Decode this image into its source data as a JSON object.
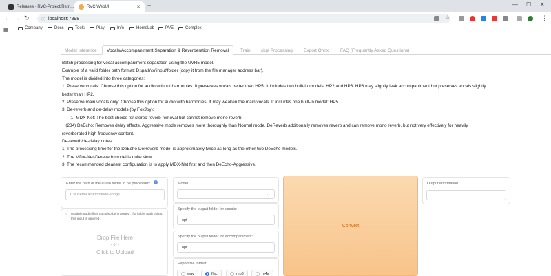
{
  "browser": {
    "tabs": [
      {
        "title": "Releases · RVC-Project/Retri…",
        "active": false
      },
      {
        "title": "RVC WebUI",
        "active": true
      }
    ],
    "url": "localhost:7898",
    "bookmarks": [
      "Company",
      "Docs",
      "Tools",
      "Play",
      "Info",
      "HomeLab",
      "PVE",
      "Complex"
    ]
  },
  "app_tabs": [
    {
      "label": "Model Inference",
      "selected": false
    },
    {
      "label": "Vocals/Accompaniment Separation & Reverberation Removal",
      "selected": true
    },
    {
      "label": "Train",
      "selected": false
    },
    {
      "label": "ckpt Processing",
      "selected": false
    },
    {
      "label": "Export Onnx",
      "selected": false
    },
    {
      "label": "FAQ (Frequently Asked Questions)",
      "selected": false
    }
  ],
  "description": [
    "Batch processing for vocal accompaniment separation using the UVR5 model.",
    "Example of a valid folder path format: D:\\path\\to\\input\\folder (copy it from the file manager address bar).",
    "The model is divided into three categories:",
    "1. Preserve vocals: Choose this option for audio without harmonies. It preserves vocals better than HP5. It includes two built-in models: HP2 and HP3. HP3 may slightly leak accompaniment but preserves vocals slightly better than HP2.",
    "2. Preserve main vocals only: Choose this option for audio with harmonies. It may weaken the main vocals. It includes one built-in model: HP5.",
    "3. De-reverb and de-delay models (by FoxJoy):",
    "      (1) MDX-Net: The best choice for stereo reverb removal but cannot remove mono reverb;",
    "   (234) DeEcho: Removes delay effects. Aggressive mode removes more thoroughly than Normal mode. DeReverb additionally removes reverb and can remove mono reverb, but not very effectively for heavily reverberated high-frequency content.",
    "De-reverb/de-delay notes:",
    "1. The processing time for the DeEcho-DeReverb model is approximately twice as long as the other two DeEcho models.",
    "2. The MDX-Net-Dereverb model is quite slow.",
    "3. The recommended cleanest configuration is to apply MDX-Net first and then DeEcho-Aggressive."
  ],
  "form": {
    "folder_label": "Enter the path of the audio folder to be processed:",
    "folder_placeholder": "C:\\Users\\Desktop\\todo-songs",
    "upload_hint": "Multiple audio files can also be imported. If a folder path exists, this input is ignored.",
    "drop_line1": "Drop File Here",
    "drop_line2": "- or -",
    "drop_line3": "Click to Upload",
    "model_label": "Model",
    "vocals_label": "Specify the output folder for vocals:",
    "vocals_value": "opt",
    "accomp_label": "Specify the output folder for accompaniment:",
    "accomp_value": "opt",
    "format_label": "Export file format",
    "formats": [
      {
        "label": "wav",
        "checked": false
      },
      {
        "label": "flac",
        "checked": true
      },
      {
        "label": "mp3",
        "checked": false
      },
      {
        "label": "m4a",
        "checked": false
      }
    ],
    "convert_label": "Convert",
    "output_label": "Output information"
  },
  "colors": {
    "accent": "#f8c48a",
    "convert_text": "#c86a17",
    "selected_radio": "#3a6fd8"
  }
}
